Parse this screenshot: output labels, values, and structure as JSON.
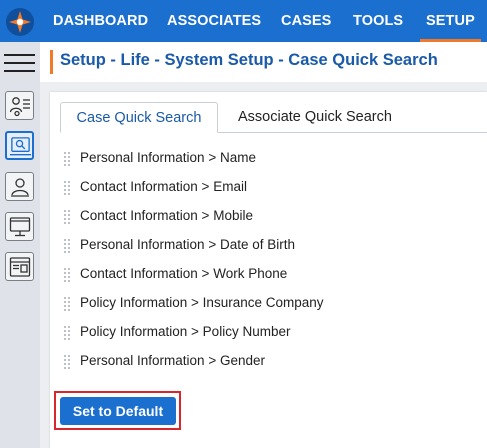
{
  "colors": {
    "primary": "#1b6fce",
    "accent": "#f07a2a",
    "highlight": "#d9262c"
  },
  "topnav": {
    "logo_icon": "app-logo-icon",
    "items": [
      {
        "label": "DASHBOARD"
      },
      {
        "label": "ASSOCIATES"
      },
      {
        "label": "CASES"
      },
      {
        "label": "TOOLS"
      },
      {
        "label": "SETUP"
      }
    ],
    "active": "SETUP"
  },
  "sidebar": {
    "menu_icon": "hamburger-menu-icon",
    "icons": [
      "user-settings-icon",
      "case-search-icon",
      "user-icon",
      "monitor-icon",
      "browser-window-icon"
    ],
    "active_index": 1
  },
  "page_title": "Setup - Life - System Setup - Case Quick Search",
  "tabs": [
    {
      "label": "Case Quick Search"
    },
    {
      "label": "Associate Quick Search"
    }
  ],
  "active_tab": "Case Quick Search",
  "fields": [
    {
      "label": "Personal Information > Name"
    },
    {
      "label": "Contact Information > Email"
    },
    {
      "label": "Contact Information > Mobile"
    },
    {
      "label": "Personal Information > Date of Birth"
    },
    {
      "label": "Contact Information > Work Phone"
    },
    {
      "label": "Policy Information > Insurance Company"
    },
    {
      "label": "Policy Information > Policy Number"
    },
    {
      "label": "Personal Information > Gender"
    }
  ],
  "reset_button": {
    "label": "Set to Default"
  }
}
